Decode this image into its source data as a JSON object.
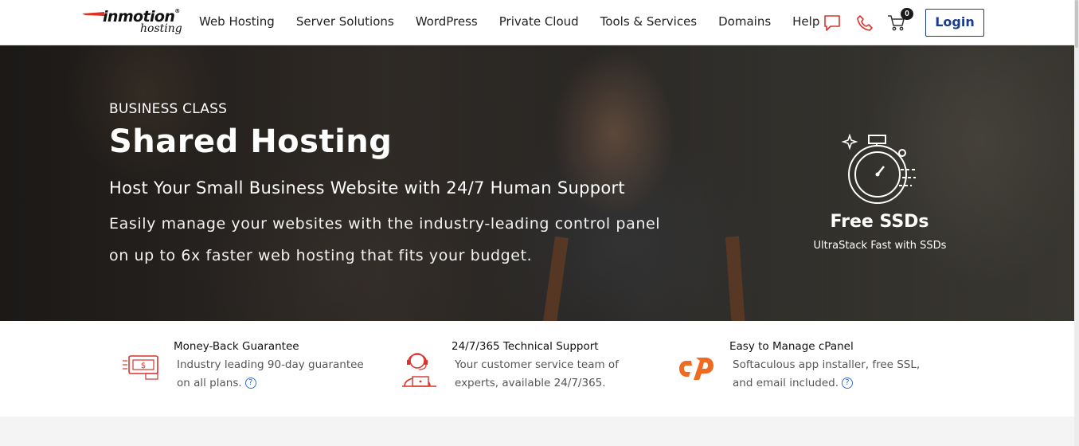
{
  "header": {
    "logo": {
      "main": "inmotion",
      "sub": "hosting"
    },
    "nav": [
      "Web Hosting",
      "Server Solutions",
      "WordPress",
      "Private Cloud",
      "Tools & Services",
      "Domains",
      "Help"
    ],
    "cart_count": "0",
    "login_label": "Login",
    "icons": [
      "chat-icon",
      "phone-icon",
      "cart-icon"
    ]
  },
  "hero": {
    "eyebrow": "BUSINESS CLASS",
    "title": "Shared Hosting",
    "subtitle": "Host Your Small Business Website with 24/7 Human Support",
    "description_line1": "Easily manage your websites with the industry-leading control panel",
    "description_line2": "on up to 6x faster web hosting that fits your budget.",
    "badge": {
      "icon": "stopwatch-icon",
      "title": "Free SSDs",
      "subtitle": "UltraStack Fast with SSDs"
    }
  },
  "features": [
    {
      "icon": "money-back-icon",
      "title": "Money-Back Guarantee",
      "line1": "Industry leading 90-day guarantee",
      "line2": "on all plans."
    },
    {
      "icon": "support-agent-icon",
      "title": "24/7/365 Technical Support",
      "line1": "Your customer service team of",
      "line2": "experts, available 24/7/365."
    },
    {
      "icon": "cpanel-icon",
      "title": "Easy to Manage cPanel",
      "line1": "Softaculous app installer, free SSL,",
      "line2": "and email included."
    }
  ],
  "help_glyph": "?",
  "colors": {
    "accent_red": "#d9342b",
    "login_blue": "#1a3b8f",
    "cpanel_orange": "#f06b22",
    "help_blue": "#3a70c8"
  }
}
